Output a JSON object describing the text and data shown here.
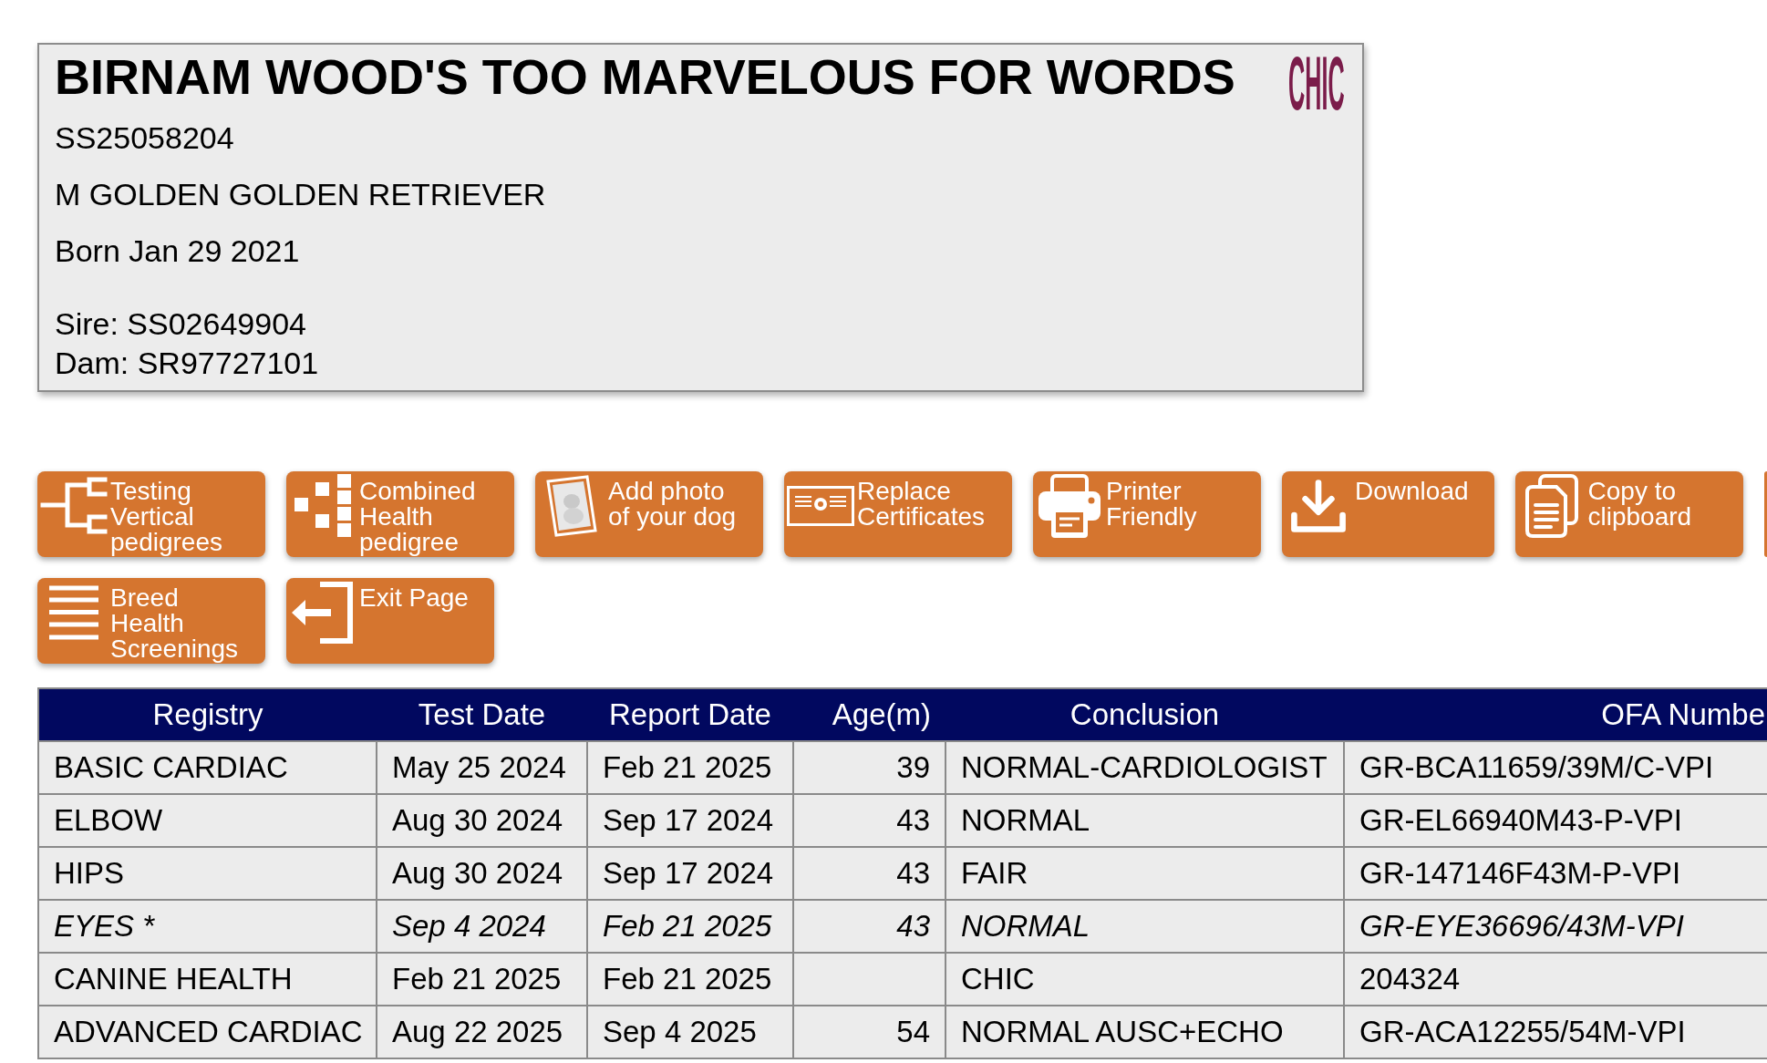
{
  "dog": {
    "name": "BIRNAM WOOD'S TOO MARVELOUS FOR WORDS",
    "logo": "CHIC",
    "registration": "SS25058204",
    "sex_breed": "M GOLDEN GOLDEN RETRIEVER",
    "born": "Born Jan 29 2021",
    "sire": "Sire: SS02649904",
    "dam": "Dam: SR97727101"
  },
  "toolbar": {
    "rows": [
      {
        "buttons": [
          {
            "kind": "pedigree",
            "label": "Testing Vertical pedigrees"
          },
          {
            "kind": "combined",
            "label": "Combined Health pedigree"
          },
          {
            "kind": "photo",
            "label": "Add photo of your dog"
          },
          {
            "kind": "certificates",
            "label": "Replace Certificates"
          },
          {
            "kind": "print",
            "label": "Printer Friendly"
          },
          {
            "kind": "download",
            "label": "Download"
          },
          {
            "kind": "copy",
            "label": "Copy to clipboard"
          }
        ]
      },
      {
        "buttons": [
          {
            "kind": "screenings",
            "label": "Breed Health Screenings"
          },
          {
            "kind": "exit",
            "label": "Exit Page"
          }
        ]
      }
    ]
  },
  "table": {
    "columns": [
      "Registry",
      "Test Date",
      "Report Date",
      "Age(m)",
      "Conclusion",
      "OFA Numbe"
    ],
    "rows": [
      {
        "italic": false,
        "registry": "BASIC CARDIAC",
        "test_date": "May 25 2024",
        "report_date": "Feb 21 2025",
        "age_m": "39",
        "conclusion": "NORMAL-CARDIOLOGIST",
        "column_6": "GR-BCA11659/39M/C-VPI"
      },
      {
        "italic": false,
        "registry": "ELBOW",
        "test_date": "Aug 30 2024",
        "report_date": "Sep 17 2024",
        "age_m": "43",
        "conclusion": "NORMAL",
        "column_6": "GR-EL66940M43-P-VPI"
      },
      {
        "italic": false,
        "registry": "HIPS",
        "test_date": "Aug 30 2024",
        "report_date": "Sep 17 2024",
        "age_m": "43",
        "conclusion": "FAIR",
        "column_6": "GR-147146F43M-P-VPI"
      },
      {
        "italic": true,
        "registry": "EYES *",
        "test_date": "Sep 4 2024",
        "report_date": "Feb 21 2025",
        "age_m": "43",
        "conclusion": "NORMAL",
        "column_6": "GR-EYE36696/43M-VPI"
      },
      {
        "italic": false,
        "registry": "CANINE HEALTH",
        "test_date": "Feb 21 2025",
        "report_date": "Feb 21 2025",
        "conclusion": "CHIC",
        "column_6": "204324"
      },
      {
        "italic": false,
        "registry": "ADVANCED CARDIAC",
        "test_date": "Aug 22 2025",
        "report_date": "Sep 4 2025",
        "age_m": "54",
        "conclusion": "NORMAL AUSC+ECHO",
        "column_6": "GR-ACA12255/54M-VPI"
      }
    ]
  }
}
